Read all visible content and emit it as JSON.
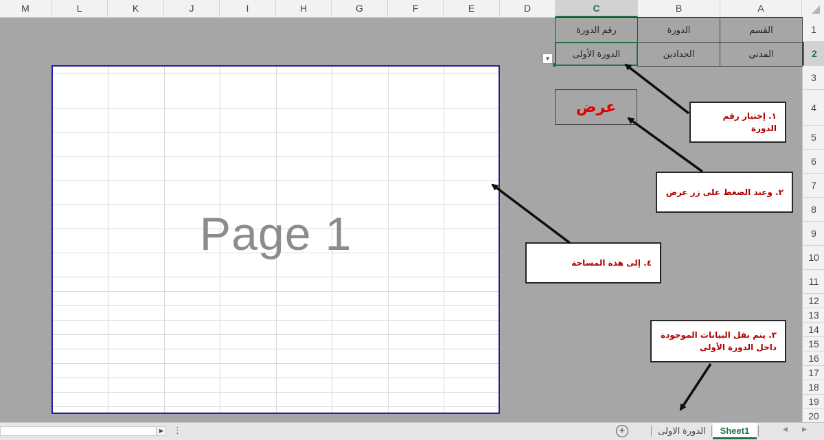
{
  "columns": [
    "M",
    "L",
    "K",
    "J",
    "I",
    "H",
    "G",
    "F",
    "E",
    "D",
    "C",
    "B",
    "A"
  ],
  "active_column": "C",
  "rows": [
    "1",
    "2",
    "3",
    "4",
    "5",
    "6",
    "7",
    "8",
    "9",
    "10",
    "11",
    "12",
    "13",
    "14",
    "15",
    "16",
    "17",
    "18",
    "19",
    "20"
  ],
  "active_row": "2",
  "table": {
    "header": {
      "a": "القسم",
      "b": "الدورة",
      "c": "رقم الدورة"
    },
    "row2": {
      "a": "المدني",
      "b": "الحدادين",
      "c": "الدورة الأولى"
    }
  },
  "show_button": "عرض",
  "page_label": "Page 1",
  "callouts": {
    "step1": "١. إختيار رقم الدورة",
    "step2": "٢. وعند الضغط على زر عرض",
    "step3_line1": "٣. يتم نقل البيانات الموجودة",
    "step3_line2": "داخل الدورة الأولى",
    "step4": "٤. إلى هذة المساحة"
  },
  "sheet_tabs": {
    "sheet1": "Sheet1",
    "course1": "الدورة الاولى"
  },
  "colors": {
    "accent": "#217346",
    "callout_text": "#b00000",
    "show_text": "#e00000",
    "page_border": "#1f1fa0"
  }
}
